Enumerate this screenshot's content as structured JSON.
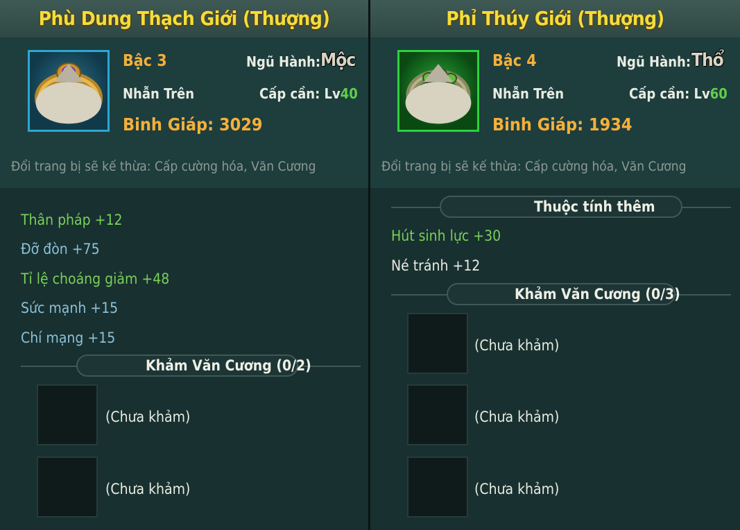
{
  "left": {
    "name": "Phù Dung Thạch Giới (Thượng)",
    "tier": "Bậc 3",
    "element_label": "Ngũ Hành:",
    "element_value": "Mộc",
    "slot_type": "Nhẫn Trên",
    "level_label": "Cấp cần: Lv",
    "level_value": "40",
    "armor": "Binh Giáp: 3029",
    "inherit_note": "Đổi trang bị sẽ kế thừa: Cấp cường hóa, Văn Cương",
    "stats": [
      {
        "text": "Thân pháp  +12",
        "color": "green"
      },
      {
        "text": "Đỡ đòn  +75",
        "color": "blue"
      },
      {
        "text": "Tỉ lệ choáng giảm   +48",
        "color": "green"
      },
      {
        "text": "Sức mạnh  +15",
        "color": "blue"
      },
      {
        "text": "Chí mạng  +15",
        "color": "blue"
      }
    ],
    "socket_header": "Khảm Văn Cương (0/2)",
    "sockets": [
      "(Chưa khảm)",
      "(Chưa khảm)"
    ],
    "frame_color": "#2aa8d2"
  },
  "right": {
    "name": "Phỉ Thúy Giới (Thượng)",
    "tier": "Bậc 4",
    "element_label": "Ngũ Hành:",
    "element_value": "Thổ",
    "slot_type": "Nhẫn Trên",
    "level_label": "Cấp cần: Lv",
    "level_value": "60",
    "armor": "Binh Giáp: 1934",
    "inherit_note": "Đổi trang bị sẽ kế thừa: Cấp cường hóa, Văn Cương",
    "extra_header": "Thuộc tính thêm",
    "stats": [
      {
        "text": "Hút sinh lực   +30",
        "color": "green"
      },
      {
        "text": "Né tránh  +12",
        "color": "white"
      }
    ],
    "socket_header": "Khảm Văn Cương (0/3)",
    "sockets": [
      "(Chưa khảm)",
      "(Chưa khảm)",
      "(Chưa khảm)"
    ],
    "frame_color": "#2bd23a"
  },
  "icons": [
    "purple-gem-ring-icon",
    "jade-ring-icon",
    "bag-icon"
  ]
}
